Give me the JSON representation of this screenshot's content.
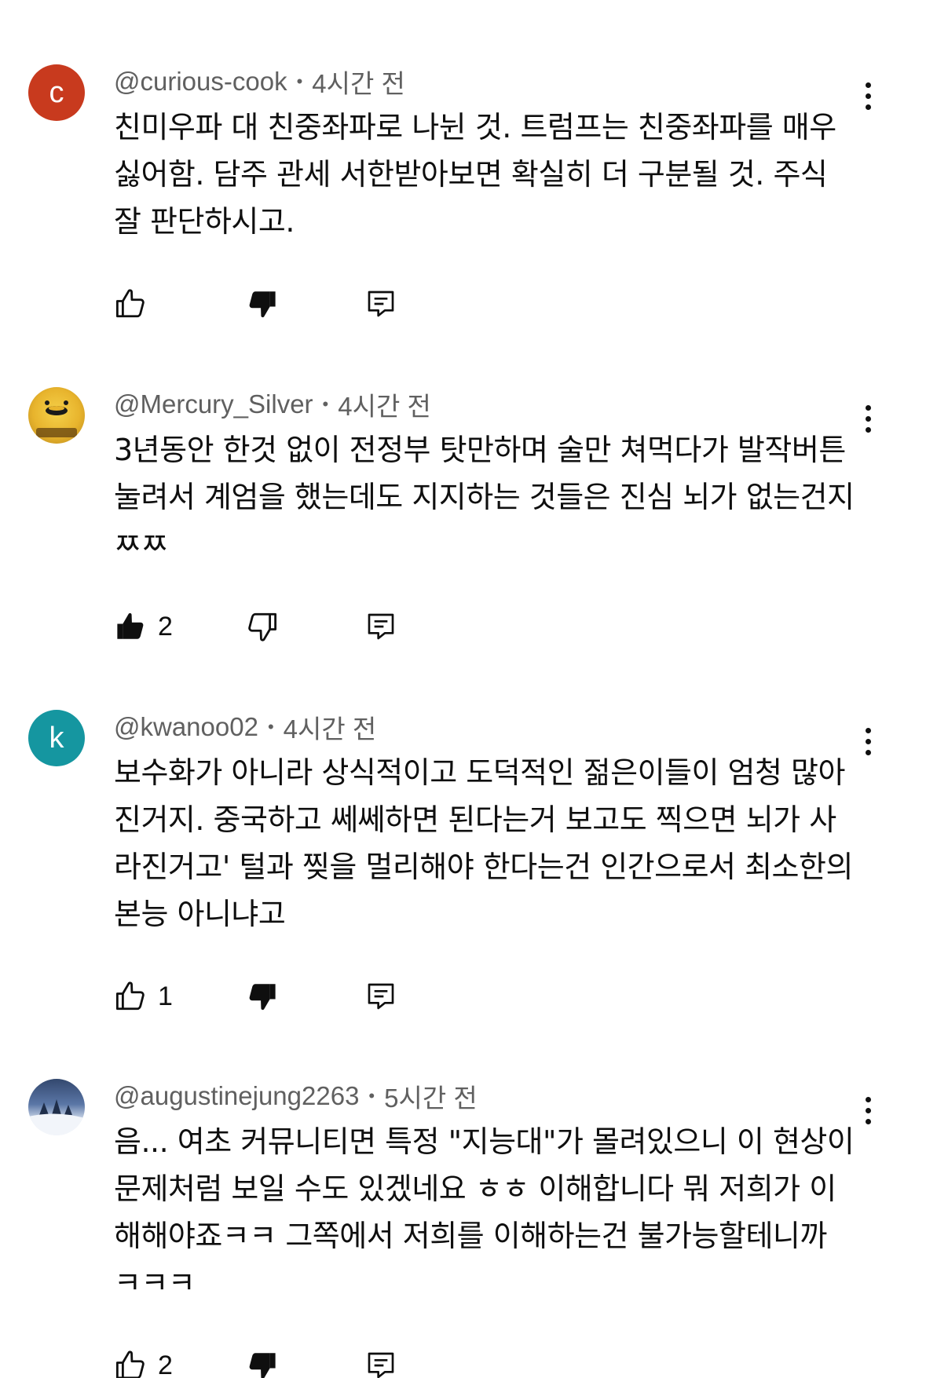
{
  "comments": [
    {
      "avatar_letter": "c",
      "author": "@curious-cook",
      "separator": "•",
      "time": "4시간 전",
      "text": "친미우파 대 친중좌파로 나뉜 것. 트럼프는 친중좌파를 매우 싫어함. 담주 관세 서한받아보면 확실히 더 구분될 것. 주식 잘 판단하시고.",
      "likes": "",
      "liked": false,
      "disliked": true
    },
    {
      "avatar_letter": "",
      "author": "@Mercury_Silver",
      "separator": "•",
      "time": "4시간 전",
      "text": "3년동안 한것 없이 전정부 탓만하며 술만 쳐먹다가 발작버튼 눌려서 계엄을 했는데도 지지하는 것들은 진심 뇌가 없는건지 ㅉㅉ",
      "likes": "2",
      "liked": true,
      "disliked": false
    },
    {
      "avatar_letter": "k",
      "author": "@kwanoo02",
      "separator": "•",
      "time": "4시간 전",
      "text": "보수화가 아니라 상식적이고 도덕적인 젊은이들이 엄청 많아진거지. 중국하고 쎄쎄하면 된다는거 보고도 찍으면 뇌가 사라진거고' 털과 찢을 멀리해야 한다는건 인간으로서 최소한의 본능 아니냐고",
      "likes": "1",
      "liked": false,
      "disliked": true
    },
    {
      "avatar_letter": "",
      "author": "@augustinejung2263",
      "separator": "•",
      "time": "5시간 전",
      "text": "음... 여초 커뮤니티면 특정 \"지능대\"가 몰려있으니 이 현상이 문제처럼 보일 수도 있겠네요 ㅎㅎ 이해합니다 뭐 저희가 이해해야죠ㅋㅋ 그쪽에서 저희를 이해하는건 불가능할테니까 ㅋㅋㅋ",
      "likes": "2",
      "liked": false,
      "disliked": true
    }
  ],
  "icons": {
    "like": "thumb-up-icon",
    "dislike": "thumb-down-icon",
    "reply": "reply-icon",
    "more": "more-vert-icon"
  }
}
